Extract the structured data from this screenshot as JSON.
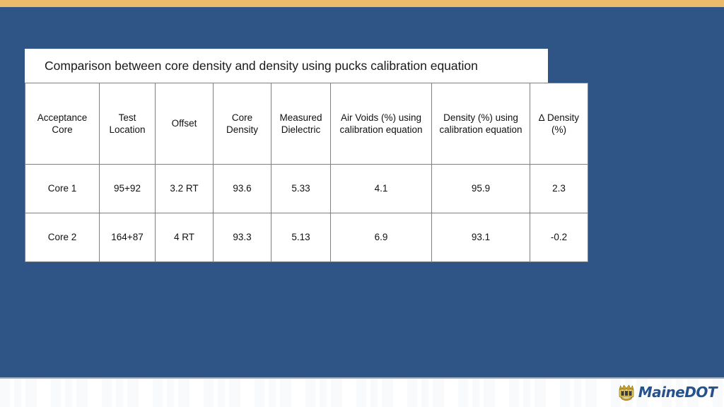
{
  "slide": {
    "background_color": "#2e5585",
    "accent_bar_color": "#ebba6b",
    "footer_background": "#ffffff"
  },
  "table": {
    "title": "Comparison between core density and density using pucks calibration equation",
    "headers": [
      "Acceptance Core",
      "Test Location",
      "Offset",
      "Core Density",
      "Measured Dielectric",
      "Air Voids (%) using calibration equation",
      "Density (%) using calibration equation",
      "∆ Density (%)"
    ],
    "rows": [
      {
        "acceptance_core": "Core 1",
        "test_location": "95+92",
        "offset": "3.2 RT",
        "core_density": "93.6",
        "measured_dielectric": "5.33",
        "air_voids_calibration": "4.1",
        "density_calibration": "95.9",
        "delta_density": "2.3"
      },
      {
        "acceptance_core": "Core 2",
        "test_location": "164+87",
        "offset": "4 RT",
        "core_density": "93.3",
        "measured_dielectric": "5.13",
        "air_voids_calibration": "6.9",
        "density_calibration": "93.1",
        "delta_density": "-0.2"
      }
    ]
  },
  "footer": {
    "logo_text": "MaineDOT",
    "logo_color": "#23528e"
  }
}
